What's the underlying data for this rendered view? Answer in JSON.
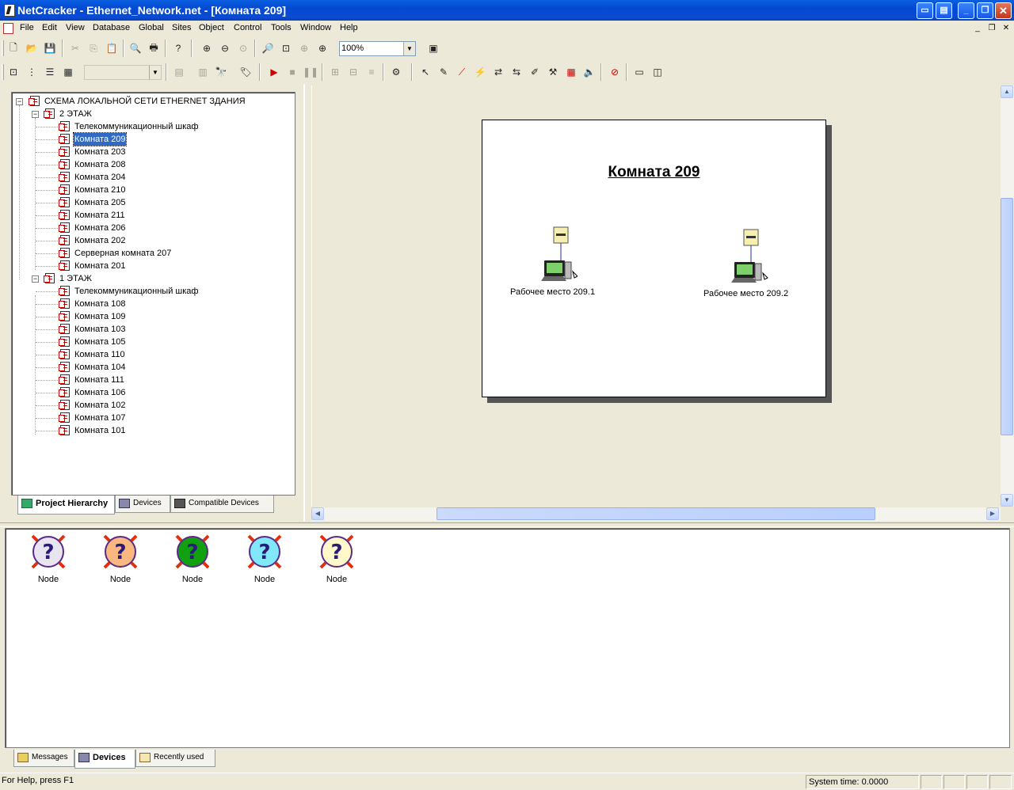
{
  "window": {
    "title": "NetCracker - Ethernet_Network.net - [Комната 209]",
    "controls": [
      "help-box",
      "help-box-2",
      "minimize",
      "restore",
      "close"
    ]
  },
  "menu": {
    "items": [
      "File",
      "Edit",
      "View",
      "Database",
      "Global",
      "Sites",
      "Object",
      "Control",
      "Tools",
      "Window",
      "Help"
    ]
  },
  "toolbar1": {
    "zoom_value": "100%"
  },
  "toolbar2": {
    "combo_value": ""
  },
  "tree": {
    "root": "СХЕМА ЛОКАЛЬНОЙ СЕТИ ETHERNET ЗДАНИЯ",
    "floors": [
      {
        "label": "2 ЭТАЖ",
        "items": [
          "Телекоммуникационный шкаф",
          "Комната 209",
          "Комната 203",
          "Комната 208",
          "Комната 204",
          "Комната 210",
          "Комната 205",
          "Комната 211",
          "Комната 206",
          "Комната 202",
          "Серверная комната 207",
          "Комната 201"
        ]
      },
      {
        "label": "1 ЭТАЖ",
        "items": [
          "Телекоммуникационный шкаф",
          "Комната 108",
          "Комната 109",
          "Комната 103",
          "Комната 105",
          "Комната 110",
          "Комната 104",
          "Комната 111",
          "Комната 106",
          "Комната 102",
          "Комната 107",
          "Комната 101"
        ]
      }
    ],
    "selected": "Комната 209"
  },
  "left_tabs": [
    "Project Hierarchy",
    "Devices",
    "Compatible Devices"
  ],
  "workspace": {
    "title": "Комната 209",
    "devices": [
      {
        "label": "Рабочее место 209.1"
      },
      {
        "label": "Рабочее место 209.2"
      }
    ]
  },
  "bottom": {
    "nodes": [
      {
        "label": "Node",
        "color": "#e8e4f0"
      },
      {
        "label": "Node",
        "color": "#f8b880"
      },
      {
        "label": "Node",
        "color": "#10a010"
      },
      {
        "label": "Node",
        "color": "#80e8f8"
      },
      {
        "label": "Node",
        "color": "#fff8c8"
      }
    ],
    "tabs": [
      "Messages",
      "Devices",
      "Recently used"
    ]
  },
  "status": {
    "help": "For Help, press F1",
    "system_time": "System time: 0.0000"
  }
}
